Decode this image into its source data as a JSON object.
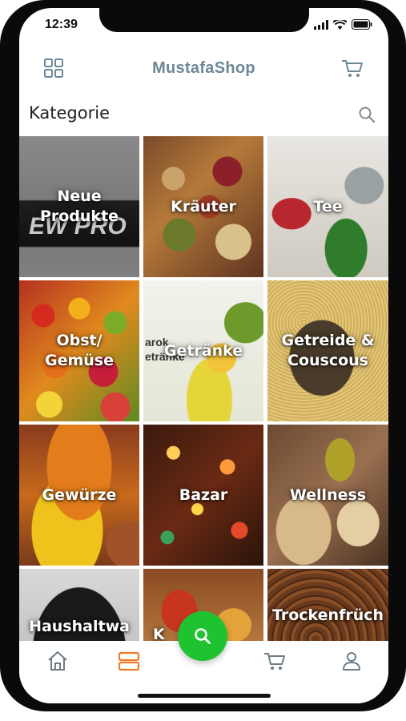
{
  "status_bar": {
    "time": "12:39"
  },
  "header": {
    "title": "MustafaShop"
  },
  "section": {
    "title": "Kategorie"
  },
  "categories": [
    {
      "label": "Neue\nProdukte"
    },
    {
      "label": "Kräuter"
    },
    {
      "label": "Tee"
    },
    {
      "label": "Obst/\nGemüse"
    },
    {
      "label": "Getränke"
    },
    {
      "label": "Getreide &\nCouscous"
    },
    {
      "label": "Gewürze"
    },
    {
      "label": "Bazar"
    },
    {
      "label": "Wellness"
    },
    {
      "label": "Haushaltwa"
    },
    {
      "label": "K"
    },
    {
      "label": "Trockenfrüch"
    }
  ],
  "tile_watermarks": {
    "neue_produkte": "EW PRO",
    "getranke": "arok\netränke"
  },
  "tabbar": {
    "items": [
      {
        "icon": "home-icon"
      },
      {
        "icon": "categories-icon",
        "active": true
      },
      {
        "icon": "search-icon"
      },
      {
        "icon": "cart-icon"
      },
      {
        "icon": "user-icon"
      }
    ]
  },
  "colors": {
    "accent_green": "#1fc32f",
    "active_tab": "#f07a2a",
    "title": "#6d8796"
  }
}
